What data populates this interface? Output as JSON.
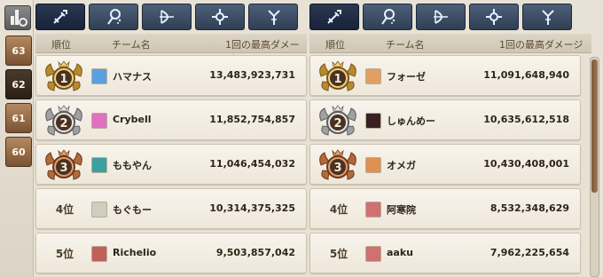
{
  "rail": {
    "filter_icon": "ranking-filter-icon",
    "levels": [
      {
        "label": "63",
        "active": false
      },
      {
        "label": "62",
        "active": true
      },
      {
        "label": "61",
        "active": false
      },
      {
        "label": "60",
        "active": false
      }
    ]
  },
  "category_tabs": [
    {
      "icon": "sword-icon",
      "active": true
    },
    {
      "icon": "magic-staff-icon",
      "active": false
    },
    {
      "icon": "bow-icon",
      "active": false
    },
    {
      "icon": "cross-shield-icon",
      "active": false
    },
    {
      "icon": "healer-staff-icon",
      "active": false
    }
  ],
  "columns": {
    "rank": "順位",
    "team": "チーム名",
    "damage": "1回の最高ダメージ"
  },
  "colors": {
    "gold": "#c9a24a",
    "silver": "#a8a8a8",
    "bronze": "#b06a3a",
    "tab_blue": "#3a4b63"
  },
  "left_panel": {
    "rows": [
      {
        "rank": "1",
        "medal": "gold",
        "team": "ハマナス",
        "damage": "13,483,923,731",
        "icon_color": "#5aa0e0"
      },
      {
        "rank": "2",
        "medal": "silver",
        "team": "Crybell",
        "damage": "11,852,754,857",
        "icon_color": "#e070c0"
      },
      {
        "rank": "3",
        "medal": "bronze",
        "team": "ももやん",
        "damage": "11,046,454,032",
        "icon_color": "#3aa0a0"
      },
      {
        "rank": "4位",
        "medal": "none",
        "team": "もぐもー",
        "damage": "10,314,375,325",
        "icon_color": "#d0ccc0"
      },
      {
        "rank": "5位",
        "medal": "none",
        "team": "Richelio",
        "damage": "9,503,857,042",
        "icon_color": "#c0605a"
      }
    ]
  },
  "right_panel": {
    "rows": [
      {
        "rank": "1",
        "medal": "gold",
        "team": "フォーゼ",
        "damage": "11,091,648,940",
        "icon_color": "#e0a060"
      },
      {
        "rank": "2",
        "medal": "silver",
        "team": "しゅんめー",
        "damage": "10,635,612,518",
        "icon_color": "#3a2020"
      },
      {
        "rank": "3",
        "medal": "bronze",
        "team": "オメガ",
        "damage": "10,430,408,001",
        "icon_color": "#e09050"
      },
      {
        "rank": "4位",
        "medal": "none",
        "team": "阿寒院",
        "damage": "8,532,348,629",
        "icon_color": "#d07070"
      },
      {
        "rank": "5位",
        "medal": "none",
        "team": "aaku",
        "damage": "7,962,225,654",
        "icon_color": "#d07070"
      }
    ]
  }
}
